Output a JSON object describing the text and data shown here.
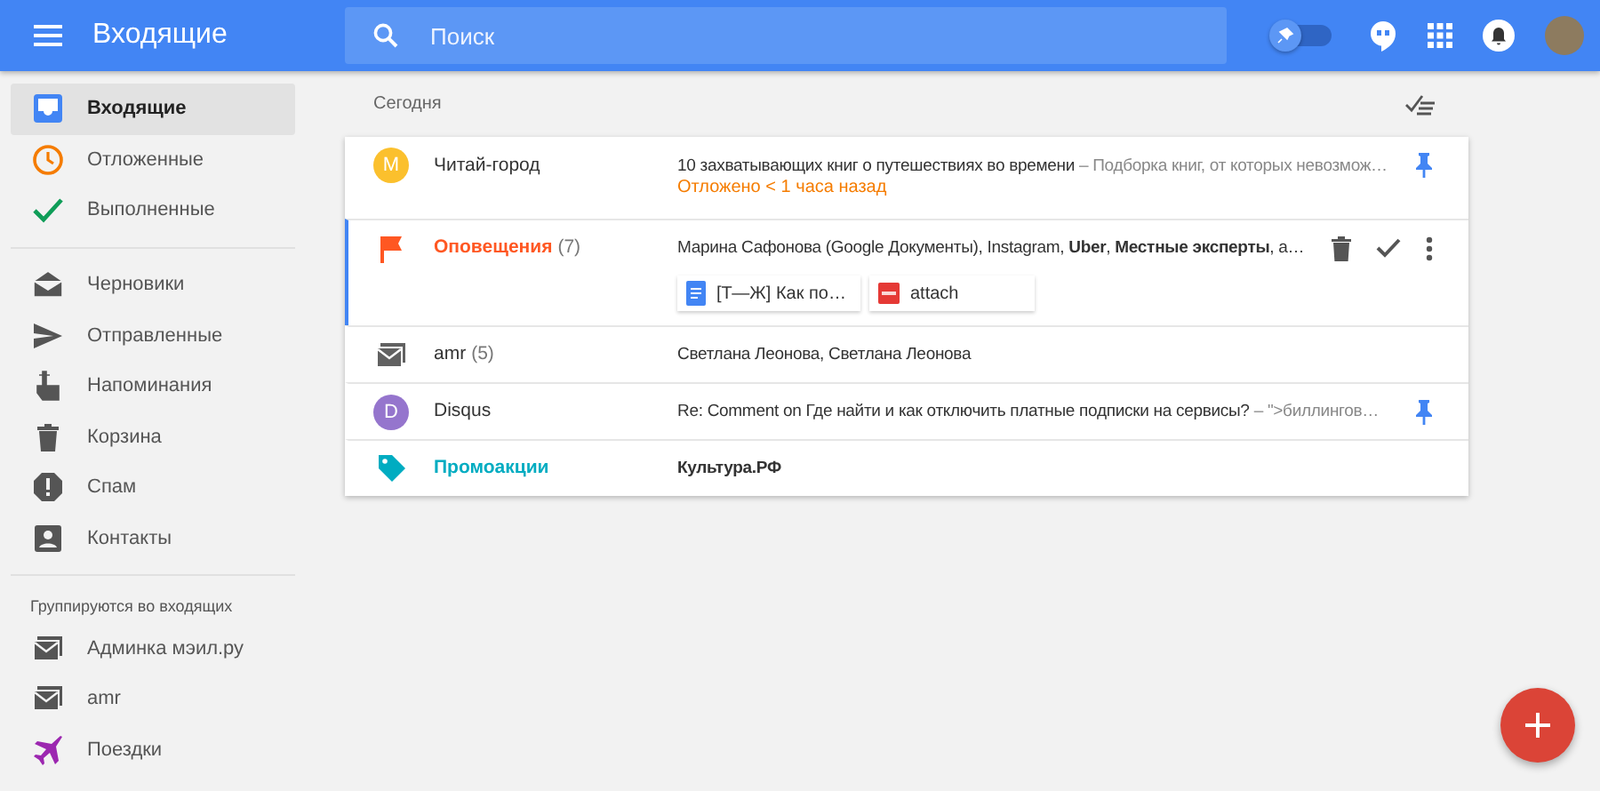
{
  "header": {
    "title": "Входящие",
    "search": {
      "placeholder": "Поиск"
    },
    "pin_toggle": {
      "on": false
    }
  },
  "sidebar": {
    "items": [
      {
        "kind": "inbox",
        "label": "Входящие",
        "selected": true
      },
      {
        "kind": "clock",
        "label": "Отложенные",
        "selected": false
      },
      {
        "kind": "check",
        "label": "Выполненные",
        "selected": false
      },
      {
        "kind": "divider"
      },
      {
        "kind": "drafts",
        "label": "Черновики",
        "selected": false
      },
      {
        "kind": "send",
        "label": "Отправленные",
        "selected": false
      },
      {
        "kind": "reminder",
        "label": "Напоминания",
        "selected": false
      },
      {
        "kind": "trash",
        "label": "Корзина",
        "selected": false
      },
      {
        "kind": "spam",
        "label": "Спам",
        "selected": false
      },
      {
        "kind": "contacts",
        "label": "Контакты",
        "selected": false
      },
      {
        "kind": "divider"
      },
      {
        "kind": "heading",
        "label": "Группируются во входящих"
      },
      {
        "kind": "bundle",
        "label": "Админка мэил.ру",
        "selected": false
      },
      {
        "kind": "bundle",
        "label": "amr",
        "selected": false
      },
      {
        "kind": "trips",
        "label": "Поездки",
        "selected": false
      }
    ]
  },
  "section": {
    "title": "Сегодня"
  },
  "messages": [
    {
      "kind": "avatar",
      "initial": "M",
      "color": "#fbc02d",
      "sender": "Читай-город",
      "subject": "10 захватывающих книг о путешествиях во времени",
      "preview": " – Подборка книг, от которых невозмож…",
      "note": "Отложено < 1 часа назад",
      "pinned": true,
      "selected": false
    },
    {
      "kind": "flag",
      "color": "#ff5722",
      "sender": "Оповещения",
      "count": "(7)",
      "subject": "Марина Сафонова (Google Документы), Instagram, **Uber**, **Местные эксперты**, а…",
      "attachments": [
        {
          "kind": "doc",
          "name": "[Т—Ж] Как по…"
        },
        {
          "kind": "pdf",
          "name": "attach"
        }
      ],
      "selected": true
    },
    {
      "kind": "bundle",
      "color": "#616161",
      "sender": "amr",
      "count": "(5)",
      "subject": "Светлана Леонова, Светлана Леонова",
      "pinned": false,
      "selected": false
    },
    {
      "kind": "avatar",
      "initial": "D",
      "color": "#9575cd",
      "sender": "Disqus",
      "subject": "Re: Comment on Где найти и как отключить платные подписки на сервисы?",
      "preview": " – \">биллингов…",
      "pinned": true,
      "selected": false
    },
    {
      "kind": "tag",
      "color": "#00acc1",
      "sender": "Промоакции",
      "subject": "**Культура.РФ**",
      "pinned": false,
      "selected": false
    }
  ]
}
